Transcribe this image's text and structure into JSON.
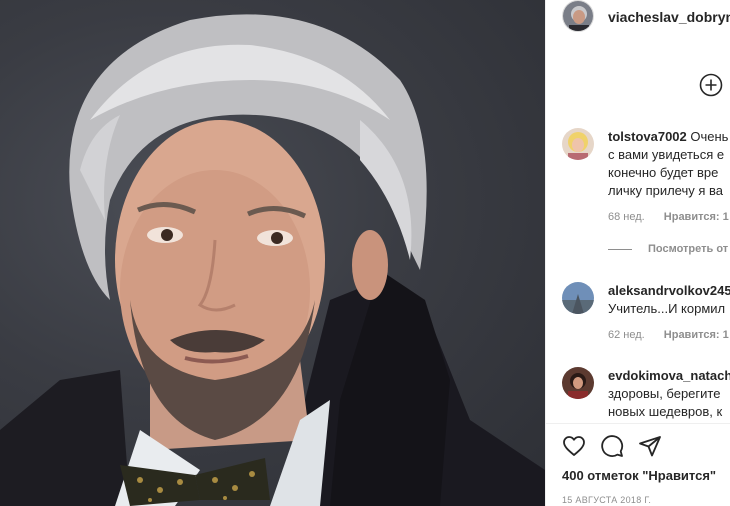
{
  "post": {
    "username": "viacheslav_dobryni",
    "likes_text": "400 отметок \"Нравится\"",
    "date": "15 АВГУСТА 2018 Г."
  },
  "comments": [
    {
      "username": "tolstova7002",
      "lines": [
        "Очень",
        "с вами увидеться е",
        "конечно будет вре",
        "личку прилечу я ва"
      ],
      "time": "68 нед.",
      "likes": "Нравится: 1"
    },
    {
      "username": "aleksandrvolkov245",
      "lines": [
        "Учитель...И кормил"
      ],
      "time": "62 нед.",
      "likes": "Нравится: 1"
    },
    {
      "username": "evdokimova_natach",
      "lines": [
        "здоровы, берегите",
        "новых шедевров, к"
      ],
      "time": "",
      "likes": ""
    }
  ],
  "replies_label": "Посмотреть от",
  "icons": {
    "add": "plus-circle-icon",
    "like": "heart-icon",
    "comment": "speech-bubble-icon",
    "share": "paper-plane-icon"
  },
  "colors": {
    "text": "#262626",
    "muted": "#8e8e8e",
    "border": "#efefef"
  }
}
